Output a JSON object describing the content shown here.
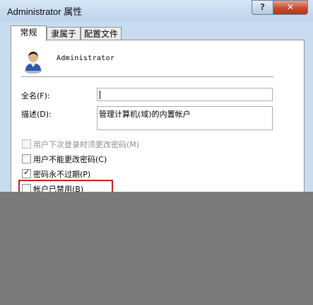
{
  "window": {
    "title": "Administrator 属性",
    "help_label": "?",
    "close_label": "✕"
  },
  "tabs": [
    {
      "label": "常规",
      "active": true
    },
    {
      "label": "隶属于",
      "active": false
    },
    {
      "label": "配置文件",
      "active": false
    }
  ],
  "general": {
    "username": "Administrator",
    "avatar_icon": "user-icon",
    "fullname_label": "全名(F):",
    "fullname_value": "",
    "description_label": "描述(D):",
    "description_value": "管理计算机(域)的内置帐户"
  },
  "options": [
    {
      "label": "用户下次登录时须更改密码(M)",
      "checked": false,
      "disabled": true
    },
    {
      "label": "用户不能更改密码(C)",
      "checked": false,
      "disabled": false
    },
    {
      "label": "密码永不过期(P)",
      "checked": true,
      "disabled": false
    },
    {
      "label": "帐户已禁用(B)",
      "checked": false,
      "disabled": false,
      "highlighted": true
    }
  ],
  "colors": {
    "highlight_border": "#c61f1f",
    "overlay": "#7a7a7a"
  }
}
